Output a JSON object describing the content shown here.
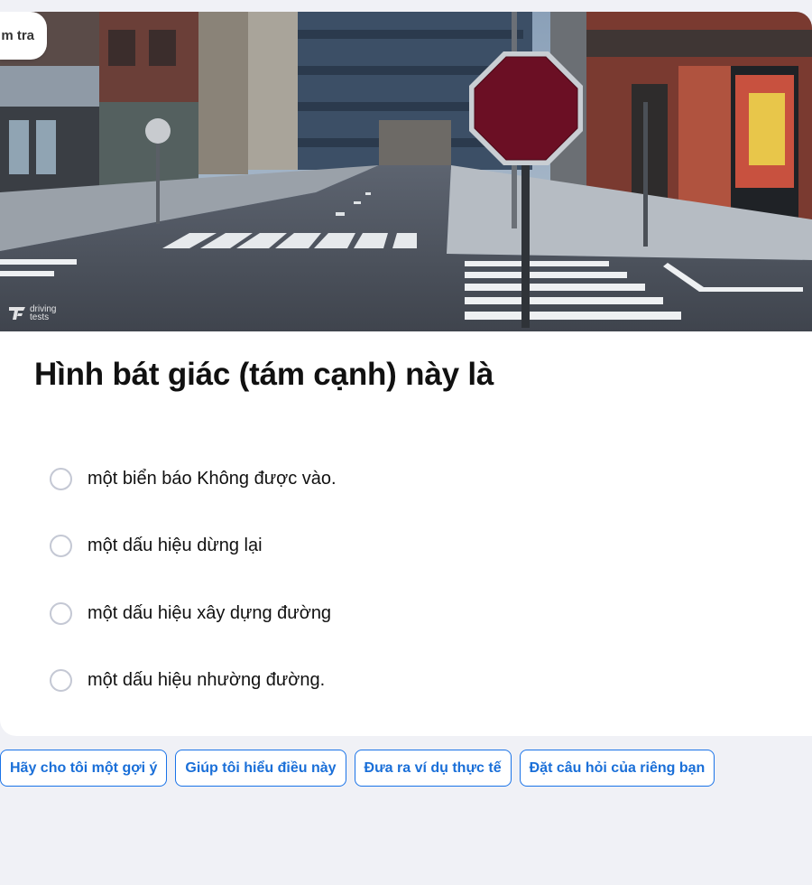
{
  "header": {
    "tab_fragment": "m tra"
  },
  "scene": {
    "logo_text_1": "driving",
    "logo_text_2": "tests",
    "sign_color": "#6b0f24"
  },
  "question": {
    "title": "Hình bát giác (tám cạnh) này là"
  },
  "options": [
    {
      "label": "một biển báo Không được vào."
    },
    {
      "label": "một dấu hiệu dừng lại"
    },
    {
      "label": "một dấu hiệu xây dựng đường"
    },
    {
      "label": "một dấu hiệu nhường đường."
    }
  ],
  "actions": [
    {
      "label": "Hãy cho tôi một gợi ý"
    },
    {
      "label": "Giúp tôi hiểu điều này"
    },
    {
      "label": "Đưa ra ví dụ thực tế"
    },
    {
      "label": "Đặt câu hỏi của riêng bạn"
    }
  ],
  "colors": {
    "accent": "#1a73e8",
    "page_bg": "#f0f1f6",
    "radio_border": "#c4c8d4"
  }
}
